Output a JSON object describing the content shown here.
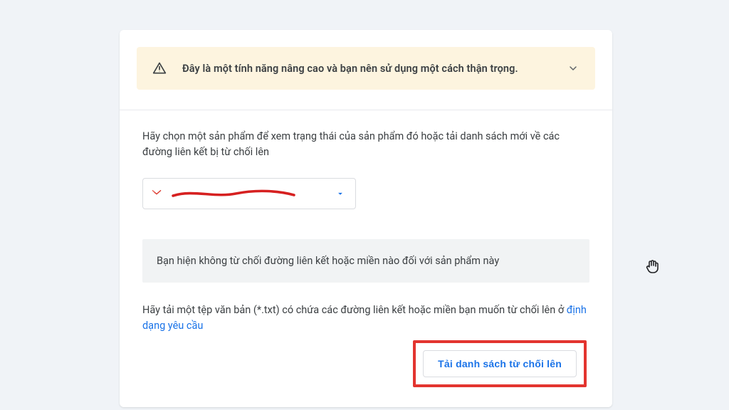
{
  "warning": {
    "message": "Đây là một tính năng nâng cao và bạn nên sử dụng một cách thận trọng."
  },
  "intro": {
    "text": "Hãy chọn một sản phẩm để xem trạng thái của sản phẩm đó hoặc tải danh sách mới về các đường liên kết bị từ chối lên"
  },
  "info": {
    "text": "Bạn hiện không từ chối đường liên kết hoặc miền nào đối với sản phẩm này"
  },
  "upload": {
    "prefix": "Hãy tải một tệp văn bản (*.txt) có chứa các đường liên kết hoặc miền bạn muốn từ chối lên ở ",
    "link": "định dạng yêu cầu"
  },
  "button": {
    "upload_label": "Tải danh sách từ chối lên"
  }
}
